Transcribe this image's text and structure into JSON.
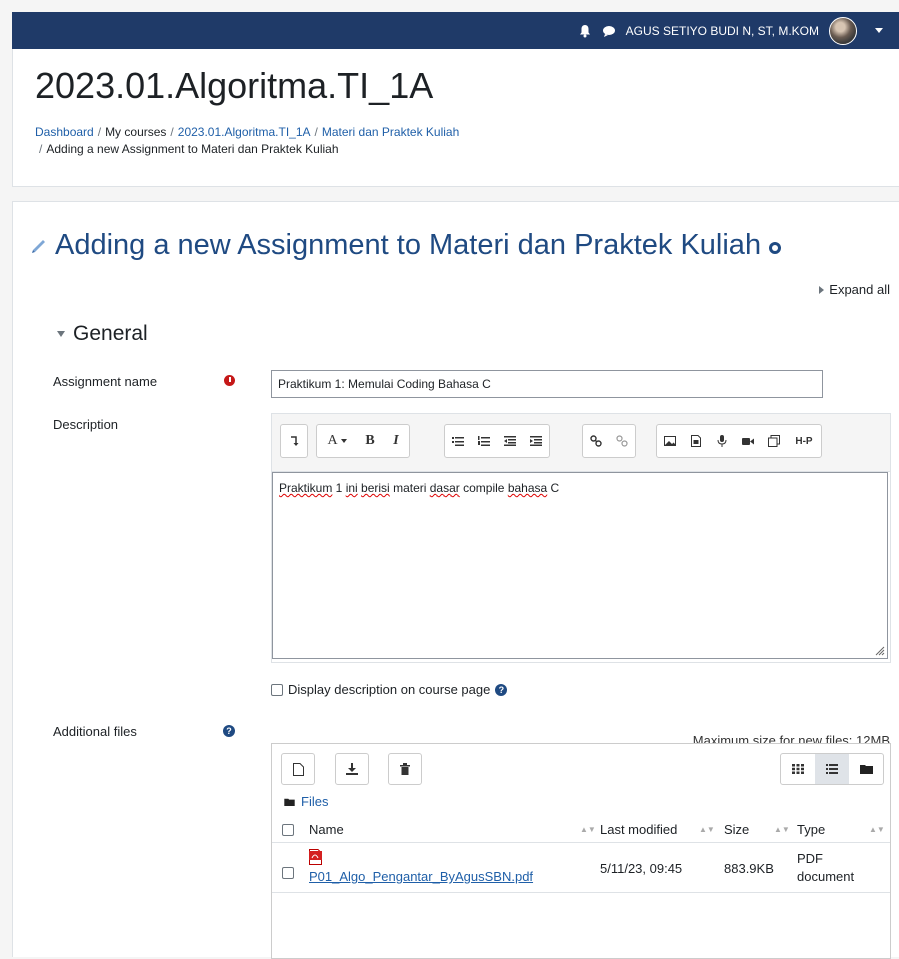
{
  "topbar": {
    "user_name": "AGUS SETIYO BUDI N, ST, M.KOM"
  },
  "course": {
    "title": "2023.01.Algoritma.TI_1A"
  },
  "breadcrumb": {
    "items": [
      "Dashboard",
      "My courses",
      "2023.01.Algoritma.TI_1A",
      "Materi dan Praktek Kuliah"
    ],
    "current": "Adding a new Assignment to Materi dan Praktek Kuliah",
    "separator": "/"
  },
  "page": {
    "heading": "Adding a new Assignment to Materi dan Praktek Kuliah",
    "expand_all": "Expand all",
    "section_general": "General"
  },
  "form": {
    "assignment_name_label": "Assignment name",
    "assignment_name_value": "Praktikum 1: Memulai Coding Bahasa C",
    "description_label": "Description",
    "description_words": [
      "Praktikum",
      " 1 ",
      "ini",
      " ",
      "berisi",
      " materi ",
      "dasar",
      " compile ",
      "bahasa",
      " C"
    ],
    "display_description_label": "Display description on course page",
    "additional_files_label": "Additional files",
    "max_size": "Maximum size for new files: 12MB"
  },
  "editor_toolbar": {
    "font_label": "A",
    "bold": "B",
    "italic": "I",
    "h5p": "H-P"
  },
  "filemanager": {
    "crumb": "Files",
    "columns": [
      "Name",
      "Last modified",
      "Size",
      "Type"
    ],
    "files": [
      {
        "name": "P01_Algo_Pengantar_ByAgusSBN.pdf",
        "modified": "5/11/23, 09:45",
        "size": "883.9KB",
        "type_line1": "PDF",
        "type_line2": "document"
      }
    ]
  },
  "colors": {
    "navbar": "#1f3a68",
    "link": "#1f5fa8",
    "heading": "#1f4a82",
    "required": "#c51818"
  }
}
